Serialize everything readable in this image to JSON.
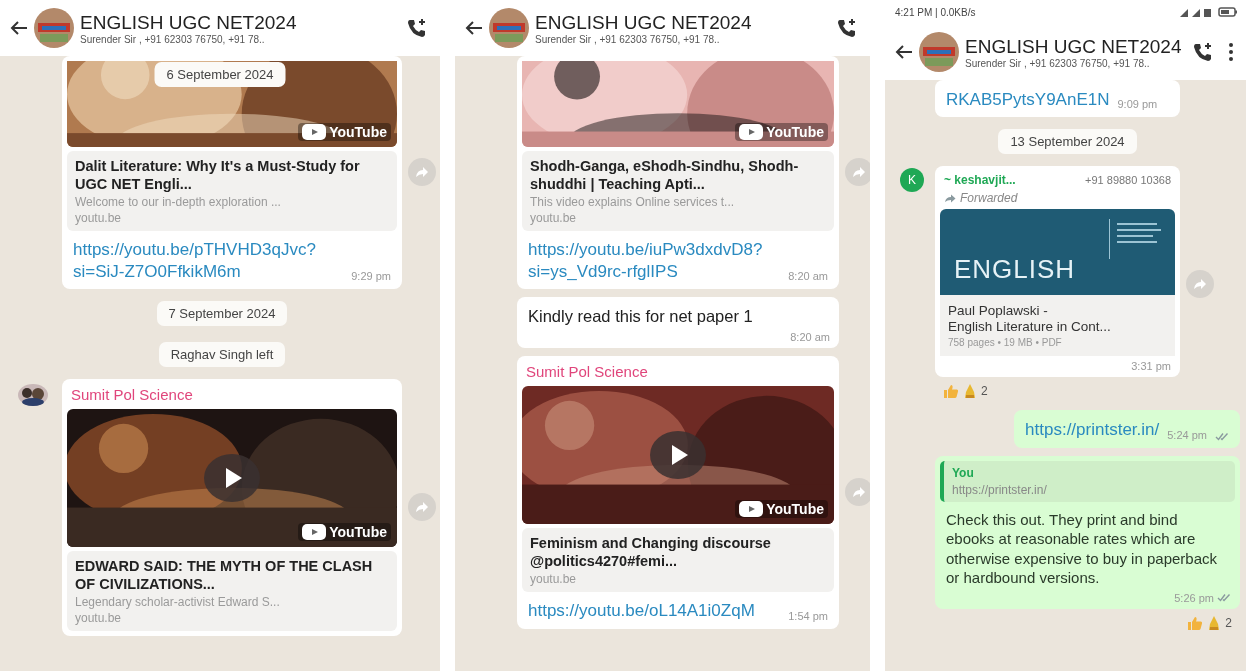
{
  "panels": [
    {
      "header": {
        "title": "ENGLISH UGC NET2024",
        "subtitle": "Surender Sir , +91 62303 76750, +91 78.."
      },
      "floating_date": "6 September 2024",
      "messages": [
        {
          "kind": "video",
          "badge": "YouTube",
          "title": "Dalit Literature: Why It's a Must-Study for UGC NET Engli...",
          "description": "Welcome to our in-depth exploration ...",
          "domain": "youtu.be",
          "link": "https://youtu.be/pTHVHD3qJvc?si=SiJ-Z7O0FfkikM6m",
          "time": "9:29 pm",
          "share": true
        },
        {
          "kind": "date",
          "text": "7 September 2024"
        },
        {
          "kind": "system",
          "text": "Raghav Singh left"
        },
        {
          "kind": "video",
          "sender": {
            "name": "Sumit Pol Science",
            "color": "#e0457b"
          },
          "badge": "YouTube",
          "title": "EDWARD SAID: THE MYTH OF THE CLASH OF CIVILIZATIONS...",
          "description": "Legendary scholar-activist Edward S...",
          "domain": "youtu.be",
          "share": true
        }
      ]
    },
    {
      "header": {
        "title": "ENGLISH UGC NET2024",
        "subtitle": "Surender Sir , +91 62303 76750, +91 78.."
      },
      "messages": [
        {
          "kind": "video",
          "badge": "YouTube",
          "title": "Shodh-Ganga, eShodh-Sindhu, Shodh-shuddhi | Teaching Apti...",
          "description": "This video explains Online services t...",
          "domain": "youtu.be",
          "link": "https://youtu.be/iuPw3dxdvD8?si=ys_Vd9rc-rfglIPS",
          "time": "8:20 am",
          "share": true
        },
        {
          "kind": "text",
          "text": "Kindly read this for net paper 1",
          "time": "8:20 am"
        },
        {
          "kind": "video",
          "sender": {
            "name": "Sumit Pol Science",
            "color": "#e0457b"
          },
          "badge": "YouTube",
          "title": "Feminism and Changing discourse @politics4270#femi...",
          "domain": "youtu.be",
          "link": "https://youtu.be/oL14A1i0ZqM",
          "time": "1:54 pm",
          "share": true
        }
      ]
    },
    {
      "status_bar": {
        "text": "4:21 PM | 0.0KB/s"
      },
      "header": {
        "title": "ENGLISH UGC NET2024",
        "subtitle": "Surender Sir , +91 62303 76750, +91 78..",
        "menu": true
      },
      "messages": [
        {
          "kind": "link",
          "link": "RKAB5PytsY9AnE1N",
          "time": "9:09 pm"
        },
        {
          "kind": "date",
          "text": "13 September 2024"
        },
        {
          "kind": "document",
          "sender": {
            "name": "~ keshavjit...",
            "color": "#1fa855"
          },
          "phone": "+91 89880 10368",
          "avatar": {
            "kind": "letter",
            "letter": "K",
            "color": "#1fa855"
          },
          "forwarded": "Forwarded",
          "cover_title": "ENGLISH",
          "title_lines": [
            "Paul Poplawski -",
            "English Literature in Cont..."
          ],
          "meta": "758 pages • 19 MB • PDF",
          "time": "3:31 pm",
          "share": true,
          "reactions": {
            "count": "2"
          }
        },
        {
          "kind": "link",
          "outgoing": true,
          "link": "https://printster.in/",
          "time": "5:24 pm",
          "read": false
        },
        {
          "kind": "reply",
          "outgoing": true,
          "quote": {
            "author": "You",
            "text": "https://printster.in/"
          },
          "text": "Check this out. They print and bind ebooks at reasonable rates which are otherwise expensive to buy in paperback or hardbound versions.",
          "time": "5:26 pm",
          "read": false,
          "reactions": {
            "count": "2"
          }
        }
      ]
    }
  ]
}
